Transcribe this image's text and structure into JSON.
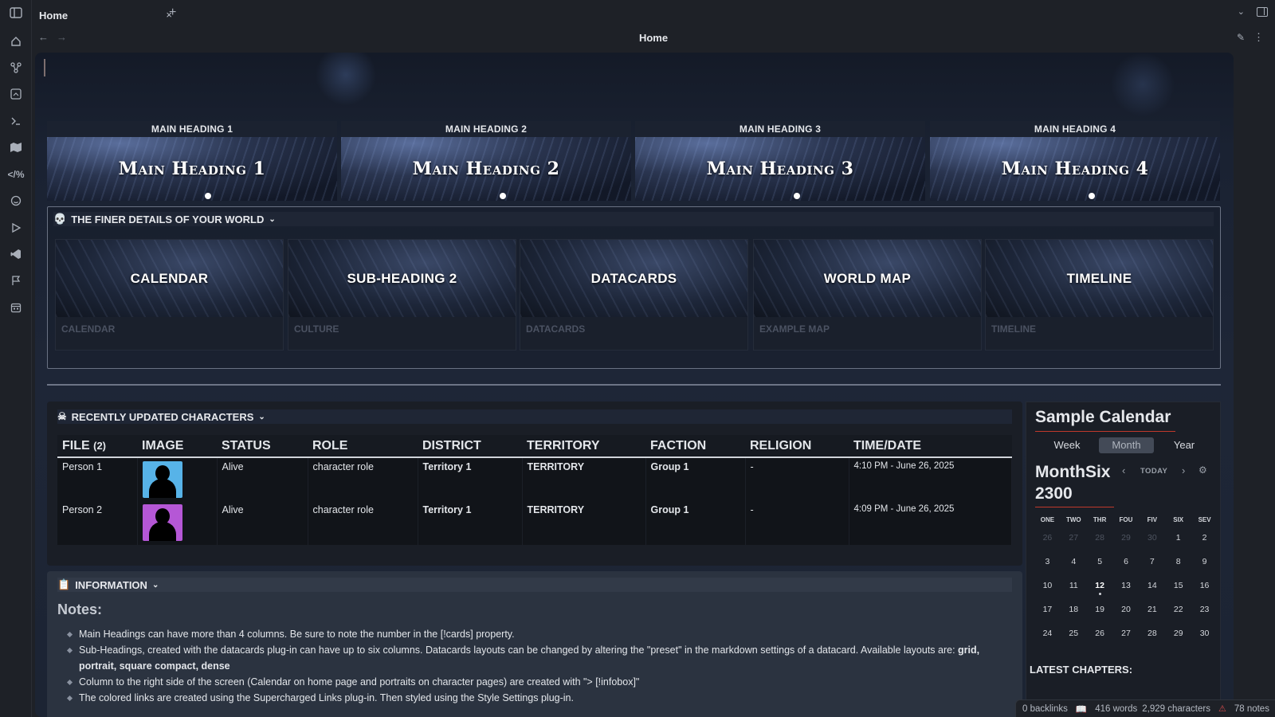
{
  "tab": {
    "title": "Home",
    "close": "×",
    "new": "+"
  },
  "view": {
    "title": "Home"
  },
  "main_headings": [
    {
      "caption": "MAIN HEADING 1",
      "title": "Main Heading 1"
    },
    {
      "caption": "MAIN HEADING 2",
      "title": "Main Heading 2"
    },
    {
      "caption": "MAIN HEADING 3",
      "title": "Main Heading 3"
    },
    {
      "caption": "MAIN HEADING 4",
      "title": "Main Heading 4"
    }
  ],
  "finer": {
    "title": "THE FINER DETAILS OF YOUR WORLD",
    "cards": [
      {
        "title": "CALENDAR",
        "label": "CALENDAR"
      },
      {
        "title": "SUB-HEADING 2",
        "label": "CULTURE"
      },
      {
        "title": "DATACARDS",
        "label": "DATACARDS"
      },
      {
        "title": "WORLD MAP",
        "label": "EXAMPLE MAP"
      },
      {
        "title": "TIMELINE",
        "label": "TIMELINE"
      }
    ]
  },
  "characters": {
    "title": "RECENTLY UPDATED CHARACTERS",
    "columns": [
      "FILE",
      "IMAGE",
      "STATUS",
      "ROLE",
      "DISTRICT",
      "TERRITORY",
      "FACTION",
      "RELIGION",
      "TIME/DATE"
    ],
    "count": "(2)",
    "rows": [
      {
        "file": "Person 1",
        "status": "Alive",
        "role": "character role",
        "district": "Territory 1",
        "territory": "TERRITORY",
        "faction": "Group 1",
        "religion": "-",
        "time": "4:10 PM - June 26, 2025",
        "avatar_color": "#57b3e8"
      },
      {
        "file": "Person 2",
        "status": "Alive",
        "role": "character role",
        "district": "Territory 1",
        "territory": "TERRITORY",
        "faction": "Group 1",
        "religion": "-",
        "time": "4:09 PM - June 26, 2025",
        "avatar_color": "#b557d6"
      }
    ]
  },
  "information": {
    "title": "INFORMATION",
    "notes_heading": "Notes:",
    "notes": [
      "Main Headings can have more than 4 columns. Be sure to note the number in the [!cards] property.",
      "Sub-Headings, created with the datacards plug-in can have up to six columns. Datacards layouts can be changed by altering the \"preset\" in the markdown settings of a datacard. Available layouts are: ",
      "Column to the right side of the screen (Calendar on home page and portraits on character pages) are created with \"> [!infobox]\"",
      "The colored links are created using the Supercharged Links plug-in. Then styled using the Style Settings plug-in."
    ],
    "layouts_bold": "grid, portrait, square compact, dense"
  },
  "calendar": {
    "title": "Sample Calendar",
    "views": [
      "Week",
      "Month",
      "Year"
    ],
    "active_view": "Month",
    "month": "MonthSix",
    "year": "2300",
    "today_label": "TODAY",
    "dows": [
      "ONE",
      "TWO",
      "THR",
      "FOU",
      "FIV",
      "SIX",
      "SEV"
    ],
    "weeks": [
      [
        "26",
        "27",
        "28",
        "29",
        "30",
        "1",
        "2"
      ],
      [
        "3",
        "4",
        "5",
        "6",
        "7",
        "8",
        "9"
      ],
      [
        "10",
        "11",
        "12",
        "13",
        "14",
        "15",
        "16"
      ],
      [
        "17",
        "18",
        "19",
        "20",
        "21",
        "22",
        "23"
      ],
      [
        "24",
        "25",
        "26",
        "27",
        "28",
        "29",
        "30"
      ]
    ],
    "current_day": "12",
    "latest_label": "LATEST CHAPTERS:"
  },
  "status": {
    "backlinks": "0 backlinks",
    "words": "416 words",
    "chars": "2,929 characters",
    "notes": "78 notes"
  },
  "colors": {
    "territory": "#9fd7a8",
    "faction": "#b78b8d",
    "accent_red": "#c0392b"
  },
  "icons": [
    "sidebar-toggle-icon",
    "home-icon",
    "graph-icon",
    "canvas-icon",
    "terminal-icon",
    "map-icon",
    "code-icon",
    "smile-icon",
    "play-icon",
    "vscode-icon",
    "flag-icon",
    "calendar-icon"
  ]
}
